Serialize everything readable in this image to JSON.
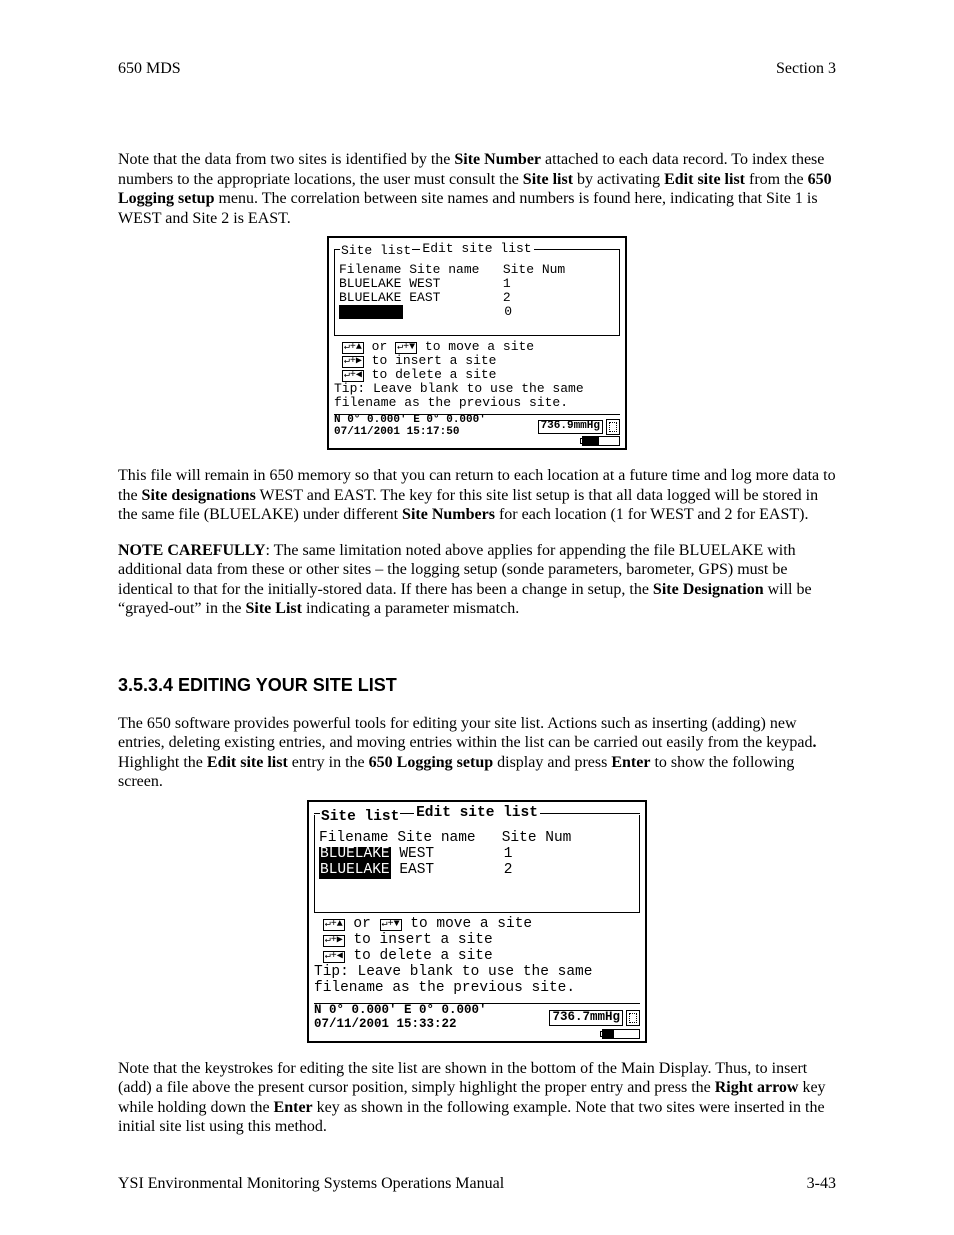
{
  "header": {
    "left": "650 MDS",
    "right": "Section 3"
  },
  "para1_a": "Note that the data from two sites is identified by the ",
  "para1_b": "Site Number",
  "para1_c": " attached to each data record.  To index these numbers to the appropriate locations, the user must consult the ",
  "para1_d": "Site list",
  "para1_e": " by activating ",
  "para1_f": "Edit site list",
  "para1_g": " from the ",
  "para1_h": "650 Logging setup",
  "para1_i": " menu.  The correlation between site names and numbers is found here, indicating that Site 1 is WEST and Site 2 is EAST.",
  "screen1": {
    "title": "Edit site list",
    "box_label": "Site list",
    "header_row": "Filename Site name   Site Num",
    "row1": "BLUELAKE WEST        1",
    "row2": "BLUELAKE EAST        2",
    "row3_num": "0",
    "hint_move": " to move a site",
    "hint_insert": " to insert a site",
    "hint_delete": " to delete a site",
    "tip1": "Tip: Leave blank to use the same",
    "tip2": "filename as the previous site.",
    "gps": "N 0° 0.000' E  0° 0.000'",
    "time": "07/11/2001 15:17:50",
    "pressure": "736.9mmHg"
  },
  "para2_a": "This file will remain in 650 memory so that you can return to each location at a future time and log more data to the ",
  "para2_b": "Site designations",
  "para2_c": " WEST and EAST.   The key for this site list setup is that all data logged will be stored in the same file (BLUELAKE) under different ",
  "para2_d": "Site Numbers",
  "para2_e": " for each location (1 for WEST and 2 for EAST).",
  "para3_a": "NOTE CAREFULLY",
  "para3_b": ": The same limitation noted above applies for appending the file BLUELAKE with additional data from these or other sites – the logging setup (sonde parameters, barometer, GPS) must be identical to that for the initially-stored data.  If there has been a change in setup, the ",
  "para3_c": "Site Designation",
  "para3_d": " will be “grayed-out” in the ",
  "para3_e": "Site List",
  "para3_f": " indicating a parameter mismatch.",
  "section_heading": "3.5.3.4 EDITING YOUR SITE LIST",
  "para4_a": "The 650 software provides powerful tools for editing your site list.   Actions such as inserting (adding) new entries, deleting existing entries, and moving entries within the list can be carried out easily from the keypad",
  "para4_b": ".",
  "para4_c": "  Highlight the ",
  "para4_d": "Edit site list",
  "para4_e": " entry in the ",
  "para4_f": "650 Logging setup",
  "para4_g": " display and press ",
  "para4_h": "Enter",
  "para4_i": " to show the following screen.",
  "screen2": {
    "title": "Edit site list",
    "box_label": "Site list",
    "header_row": "Filename Site name   Site Num",
    "row1_file": "BLUELAKE",
    "row1_rest": " WEST        1",
    "row2_file": "BLUELAKE",
    "row2_rest": " EAST        2",
    "hint_move": " to move a site",
    "hint_insert": " to insert a site",
    "hint_delete": " to delete a site",
    "tip1": "Tip: Leave blank to use the same",
    "tip2": "filename as the previous site.",
    "gps": "N 0° 0.000' E  0° 0.000'",
    "time": "07/11/2001 15:33:22",
    "pressure": "736.7mmHg"
  },
  "para5_a": "Note that the keystrokes for editing the site list are shown in the bottom of the Main Display.  Thus, to insert (add) a file above the present cursor position, simply highlight the proper entry and press the ",
  "para5_b": "Right arrow",
  "para5_c": " key while holding down the ",
  "para5_d": "Enter",
  "para5_e": " key as shown in the following example.  Note that two sites were inserted in the initial site list using this method.",
  "footer": {
    "left": "YSI Environmental Monitoring Systems Operations Manual",
    "right": "3-43"
  }
}
